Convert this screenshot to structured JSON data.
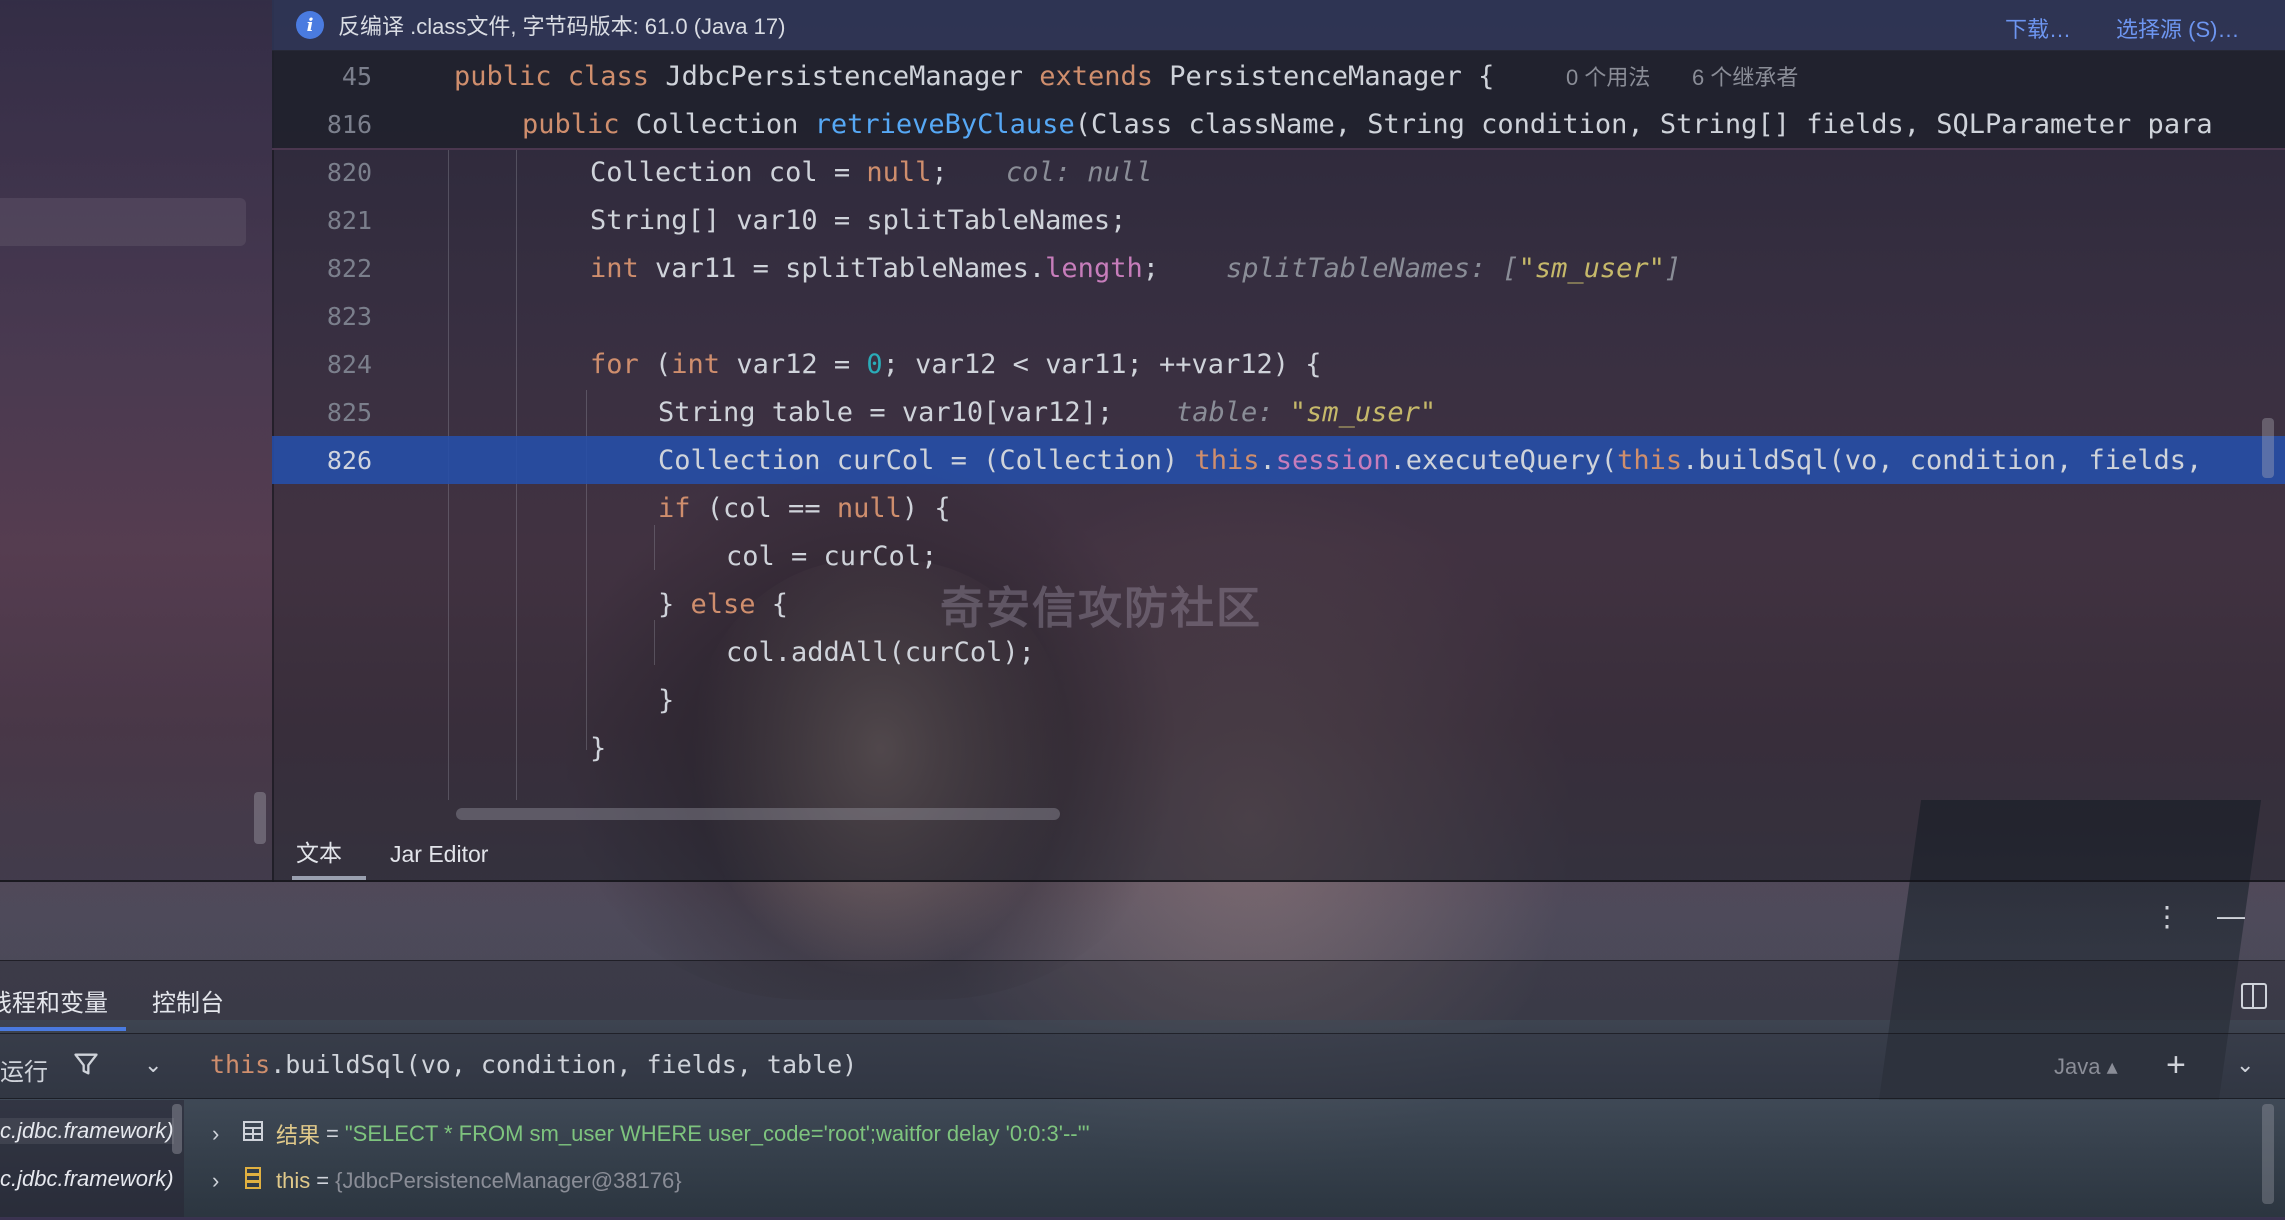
{
  "banner": {
    "text": "反编译 .class文件, 字节码版本: 61.0 (Java 17)",
    "download": "下载…",
    "select_source": "选择源 (S)…"
  },
  "sticky": {
    "l1_num": "45",
    "l1_pre": "public class ",
    "l1_class": "JdbcPersistenceManager ",
    "l1_ext": "extends ",
    "l1_super": "PersistenceManager {",
    "l1_usage": "0 个用法",
    "l1_inherit": "6 个继承者",
    "l2_num": "816",
    "l2_pre": "public ",
    "l2_type": "Collection ",
    "l2_method": "retrieveByClause",
    "l2_rest": "(Class className, String condition, String[] fields, SQLParameter para"
  },
  "code": {
    "n820": "820",
    "l820_a": "Collection col = ",
    "l820_null": "null",
    "l820_b": ";",
    "l820_hint": "col: null",
    "n821": "821",
    "l821": "String[] var10 = splitTableNames;",
    "n822": "822",
    "l822_int": "int ",
    "l822_a": "var11 = splitTableNames.",
    "l822_len": "length",
    "l822_b": ";",
    "l822_hint": "splitTableNames: [",
    "l822_hint_str": "\"sm_user\"",
    "l822_hint_end": "]",
    "n823": "823",
    "n824": "824",
    "l824_for": "for ",
    "l824_a": "(",
    "l824_int": "int ",
    "l824_b": "var12 = ",
    "l824_zero": "0",
    "l824_c": "; var12 < var11; ++var12) {",
    "n825": "825",
    "l825": "String table = var10[var12];",
    "l825_hint": "table: ",
    "l825_hint_str": "\"sm_user\"",
    "n826": "826",
    "l826_a": "Collection curCol = (Collection) ",
    "l826_this": "this",
    "l826_dot": ".",
    "l826_session": "session",
    "l826_b": ".executeQuery(",
    "l826_this2": "this",
    "l826_c": ".buildSql(vo, condition, fields, ",
    "l827_if": "if ",
    "l827_a": "(col == ",
    "l827_null": "null",
    "l827_b": ") {",
    "l828": "col = curCol;",
    "l829_a": "} ",
    "l829_else": "else ",
    "l829_b": "{",
    "l830": "col.addAll(curCol);",
    "l831": "}",
    "l832": "}"
  },
  "editor_tabs": [
    "文本",
    "Jar Editor"
  ],
  "watermark": "奇安信攻防社区",
  "debug": {
    "tabs": [
      "线程和变量",
      "控制台"
    ],
    "run_label": "运行",
    "expr_this": "this",
    "expr_rest": ".buildSql(vo, condition, fields, table)",
    "lang": "Java ▴",
    "frames": [
      "c.jdbc.framework)",
      "c.jdbc.framework)"
    ],
    "vars": [
      {
        "name": "结果",
        "value": "\"SELECT * FROM sm_user WHERE  user_code='root';waitfor delay '0:0:3'--'\""
      },
      {
        "name": "this",
        "value": "{JdbcPersistenceManager@38176}"
      }
    ]
  },
  "colors": {
    "keyword": "#cf8e6d",
    "method": "#56a8f5",
    "field": "#c77dbb",
    "string": "#e0d27a",
    "highlight": "#264eaa",
    "accent": "#4a7be0"
  },
  "icons": [
    "info-icon",
    "filter-icon",
    "chevron-down-icon",
    "add-watch-icon",
    "table-icon",
    "object-icon",
    "more-icon",
    "minimize-icon",
    "layout-icon",
    "expand-arrow-icon"
  ]
}
